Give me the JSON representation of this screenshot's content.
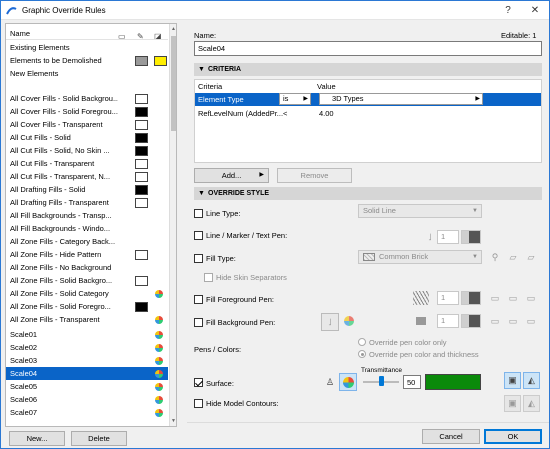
{
  "window": {
    "title": "Graphic Override Rules",
    "close_glyph": "✕",
    "help_glyph": "?"
  },
  "left_list": {
    "header": {
      "name_col": "Name"
    },
    "rows": [
      {
        "label": "Existing Elements"
      },
      {
        "label": "Elements to be Demolished",
        "fg_color": "#9a9a9a",
        "bg_color": "#ffee00"
      },
      {
        "label": "New Elements"
      },
      {
        "label": "All Cover Fills - Solid Backgrou...",
        "fg_color": "#ffffff"
      },
      {
        "label": "All Cover Fills - Solid Foregrou...",
        "fg_color": "#000000"
      },
      {
        "label": "All Cover Fills - Transparent",
        "fg_color": "#ffffff"
      },
      {
        "label": "All Cut Fills - Solid",
        "fg_color": "#000000"
      },
      {
        "label": "All Cut Fills - Solid, No Skin ...",
        "fg_color": "#000000"
      },
      {
        "label": "All Cut Fills - Transparent",
        "fg_color": "#ffffff"
      },
      {
        "label": "All Cut Fills - Transparent, N...",
        "fg_color": "#ffffff"
      },
      {
        "label": "All Drafting Fills - Solid",
        "fg_color": "#000000"
      },
      {
        "label": "All Drafting Fills - Transparent",
        "fg_color": "#ffffff"
      },
      {
        "label": "All Fill Backgrounds - Transp..."
      },
      {
        "label": "All Fill Backgrounds - Windo..."
      },
      {
        "label": "All Zone Fills - Category Back..."
      },
      {
        "label": "All Zone Fills - Hide Pattern",
        "fg_color": "#ffffff"
      },
      {
        "label": "All Zone Fills - No Background"
      },
      {
        "label": "All Zone Fills - Solid Backgro...",
        "fg_color": "#ffffff"
      },
      {
        "label": "All Zone Fills - Solid Category",
        "dot": true
      },
      {
        "label": "All Zone Fills - Solid Foregro...",
        "fg_color": "#000000"
      },
      {
        "label": "All Zone Fills - Transparent",
        "dot": true
      },
      {
        "label": "Scale01",
        "dot": true
      },
      {
        "label": "Scale02",
        "dot": true
      },
      {
        "label": "Scale03",
        "dot": true
      },
      {
        "label": "Scale04",
        "dot": true,
        "selected": true
      },
      {
        "label": "Scale05",
        "dot": true
      },
      {
        "label": "Scale06",
        "dot": true
      },
      {
        "label": "Scale07",
        "dot": true
      }
    ]
  },
  "left_buttons": {
    "new": "New...",
    "delete": "Delete"
  },
  "name_section": {
    "label": "Name:",
    "value": "Scale04",
    "editable": "Editable: 1"
  },
  "criteria": {
    "section_title": "CRITERIA",
    "columns": {
      "criteria": "Criteria",
      "value": "Value"
    },
    "rows": [
      {
        "criteria": "Element Type",
        "op": "is",
        "value": "3D Types",
        "selected": true
      },
      {
        "criteria": "RefLevelNum (AddedPr...",
        "op": "<",
        "value": "4.00"
      }
    ],
    "add_button": "Add...",
    "remove_button": "Remove"
  },
  "override": {
    "section_title": "OVERRIDE STYLE",
    "line_type": {
      "label": "Line Type:",
      "value": "Solid Line"
    },
    "line_pen": {
      "label": "Line / Marker / Text Pen:",
      "pen": "1"
    },
    "fill_type": {
      "label": "Fill Type:",
      "value": "Common Brick"
    },
    "hide_skin": {
      "label": "Hide Skin Separators"
    },
    "fill_fg_pen": {
      "label": "Fill Foreground Pen:",
      "pen": "1"
    },
    "fill_bg_pen": {
      "label": "Fill Background Pen:",
      "pen": "1"
    },
    "pens_colors": {
      "label": "Pens / Colors:",
      "opt1": "Override pen color only",
      "opt2": "Override pen color and thickness"
    },
    "surface": {
      "label": "Surface:",
      "transmittance_label": "Transmittance",
      "transmittance": "50",
      "color": "#0a8a0a",
      "checked": true
    },
    "hide_contours": {
      "label": "Hide Model Contours:"
    }
  },
  "footer": {
    "cancel": "Cancel",
    "ok": "OK"
  }
}
